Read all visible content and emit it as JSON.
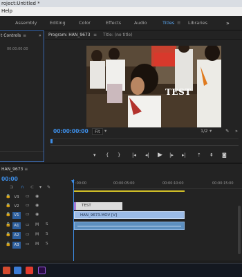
{
  "titlebar": {
    "title": "roject:Untitled *"
  },
  "menubar": {
    "help_label": "Help"
  },
  "workspaces": {
    "tabs": [
      "Assembly",
      "Editing",
      "Color",
      "Effects",
      "Audio",
      "Titles",
      "Libraries"
    ],
    "active": "Titles",
    "more": "»"
  },
  "effect_controls": {
    "title": "t Controls",
    "menu_glyph": "≡",
    "expand_glyph": "»",
    "timecode": "00:00:00:00"
  },
  "program_monitor": {
    "tab_title": "Program: HAN_9673",
    "menu_glyph": "≡",
    "title_tab": "Title: (no title)",
    "overlay_text": "TEST",
    "timecode": "00:00:00:00",
    "fit": "Fit",
    "quality": "1/2"
  },
  "timeline": {
    "sequence": "HAN_9673",
    "timecode": "00:00",
    "ruler": [
      ":00:00",
      "00:00:05:00",
      "00:00:10:00",
      "00:00:15:00"
    ],
    "tracks": [
      {
        "name": "V3",
        "targeted": false,
        "icon1": "▭",
        "icon2": "👁"
      },
      {
        "name": "V2",
        "targeted": false,
        "icon1": "▭",
        "icon2": "👁"
      },
      {
        "name": "V1",
        "targeted": true,
        "icon1": "▭",
        "icon2": "👁"
      },
      {
        "name": "A1",
        "targeted": true,
        "icon1": "▭",
        "icon2": "M",
        "icon3": "S"
      },
      {
        "name": "A2",
        "targeted": true,
        "icon1": "▭",
        "icon2": "M",
        "icon3": "S"
      },
      {
        "name": "A3",
        "targeted": true,
        "icon1": "▭",
        "icon2": "M",
        "icon3": "S"
      }
    ],
    "clips": {
      "title_clip": "TEST",
      "video_clip": "HAN_9673.MOV [V]"
    }
  },
  "colors": {
    "accent_blue": "#3d8ee8",
    "workarea_yellow": "#d4c128",
    "graphics_purple": "#a57ad6",
    "video_clip": "#9bbbe6",
    "audio_clip": "#5d8fbf"
  }
}
